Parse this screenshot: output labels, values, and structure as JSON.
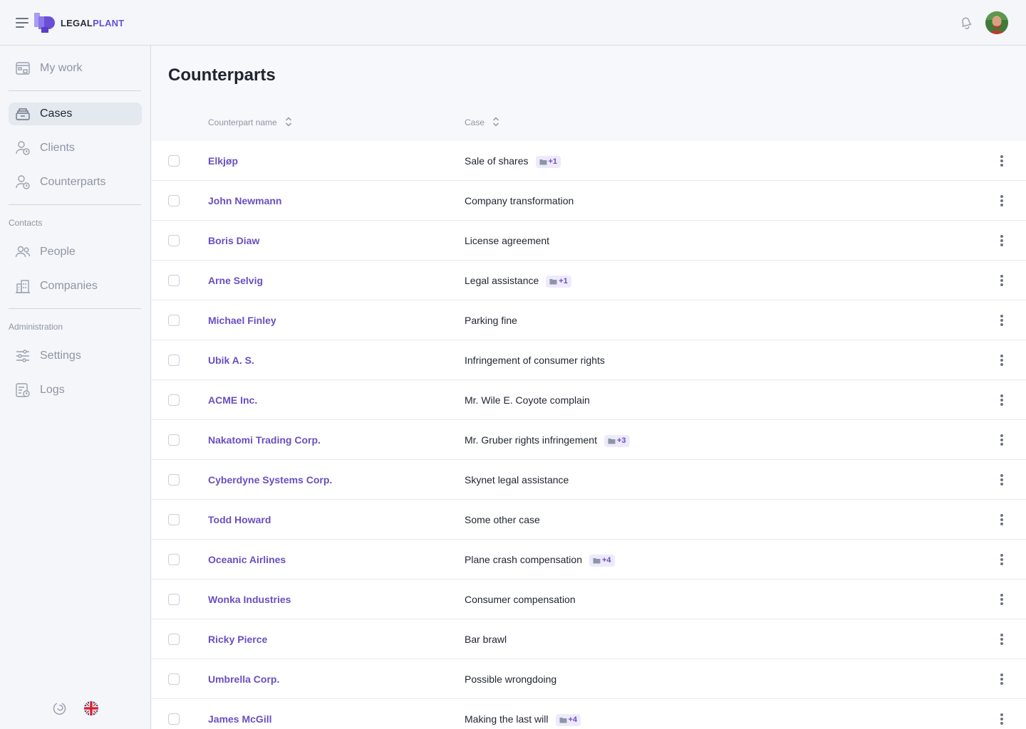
{
  "app": {
    "brand_part1": "LEGAL",
    "brand_part2": "PLANT",
    "accent": "#6a4fc0"
  },
  "sidebar": {
    "items": [
      {
        "label": "My work",
        "icon": "calendar-grid-icon"
      },
      {
        "label": "Cases",
        "icon": "archive-box-icon",
        "active": true
      },
      {
        "label": "Clients",
        "icon": "user-clock-icon"
      },
      {
        "label": "Counterparts",
        "icon": "user-clock-icon"
      },
      {
        "label": "People",
        "icon": "people-icon"
      },
      {
        "label": "Companies",
        "icon": "buildings-icon"
      },
      {
        "label": "Settings",
        "icon": "sliders-icon"
      },
      {
        "label": "Logs",
        "icon": "log-file-icon"
      }
    ],
    "section_contacts": "Contacts",
    "section_administration": "Administration"
  },
  "page": {
    "title": "Counterparts",
    "columns": {
      "name": "Counterpart name",
      "case": "Case"
    }
  },
  "rows": [
    {
      "name": "Elkjøp",
      "case": "Sale of shares",
      "badge": "+1"
    },
    {
      "name": "John Newmann",
      "case": "Company transformation",
      "badge": ""
    },
    {
      "name": "Boris Diaw",
      "case": "License agreement",
      "badge": ""
    },
    {
      "name": "Arne Selvig",
      "case": "Legal assistance",
      "badge": "+1"
    },
    {
      "name": "Michael Finley",
      "case": "Parking fine",
      "badge": ""
    },
    {
      "name": "Ubik A. S.",
      "case": "Infringement of consumer rights",
      "badge": ""
    },
    {
      "name": "ACME Inc.",
      "case": "Mr. Wile E. Coyote complain",
      "badge": ""
    },
    {
      "name": "Nakatomi Trading Corp.",
      "case": "Mr. Gruber rights infringement",
      "badge": "+3"
    },
    {
      "name": "Cyberdyne Systems Corp.",
      "case": "Skynet legal assistance",
      "badge": ""
    },
    {
      "name": "Todd Howard",
      "case": "Some other case",
      "badge": ""
    },
    {
      "name": "Oceanic Airlines",
      "case": "Plane crash compensation",
      "badge": "+4"
    },
    {
      "name": "Wonka Industries",
      "case": "Consumer compensation",
      "badge": ""
    },
    {
      "name": "Ricky Pierce",
      "case": "Bar brawl",
      "badge": ""
    },
    {
      "name": "Umbrella Corp.",
      "case": "Possible wrongdoing",
      "badge": ""
    },
    {
      "name": "James McGill",
      "case": "Making the last will",
      "badge": "+4"
    }
  ]
}
